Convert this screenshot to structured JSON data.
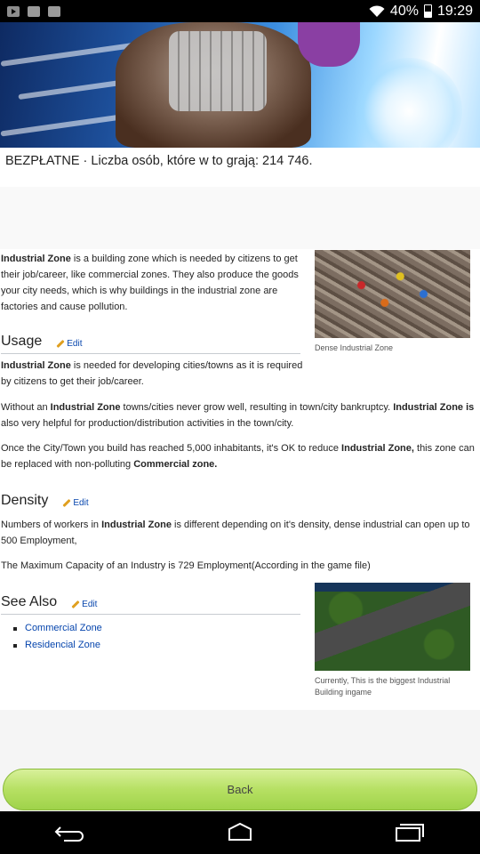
{
  "status_bar": {
    "battery": "40%",
    "time": "19:29"
  },
  "header": {
    "free_line": "BEZPŁATNE · Liczba osób, które w to grają: 214 746."
  },
  "article": {
    "intro": {
      "bold": "Industrial Zone",
      "text": " is a building zone which is needed by citizens to get their job/career, like commercial zones. They also produce the goods your city needs, which is why buildings in the industrial zone are factories and cause pollution."
    },
    "image1_caption": "Dense Industrial Zone",
    "usage": {
      "heading": "Usage",
      "edit": "Edit",
      "p1_bold": "Industrial Zone",
      "p1_text": " is needed for developing cities/towns as it is required by citizens to get their job/career.",
      "p2_a": "Without an ",
      "p2_b": "Industrial Zone",
      "p2_c": " towns/cities never grow well, resulting in town/city bankruptcy. ",
      "p2_d": "Industrial Zone is",
      "p2_e": " also very helpful for production/distribution activities in the town/city.",
      "p3_a": "Once the City/Town you build has reached 5,000 inhabitants, it's OK to reduce ",
      "p3_b": "Industrial Zone,",
      "p3_c": " this zone can be replaced with non-polluting ",
      "p3_link": "Commercial zone."
    },
    "density": {
      "heading": "Density",
      "edit": "Edit",
      "p1_a": "Numbers of workers in ",
      "p1_b": "Industrial Zone",
      "p1_c": " is different depending on it's density, dense industrial can open up to 500 Employment,",
      "p2": "The Maximum Capacity of an Industry is 729 Employment(According in the game file)"
    },
    "see_also": {
      "heading": "See Also",
      "edit": "Edit",
      "links": [
        "Commercial Zone",
        "Residencial Zone"
      ]
    },
    "image2_caption": "Currently, This is the biggest Industrial Building ingame"
  },
  "footer": {
    "back_label": "Back"
  }
}
